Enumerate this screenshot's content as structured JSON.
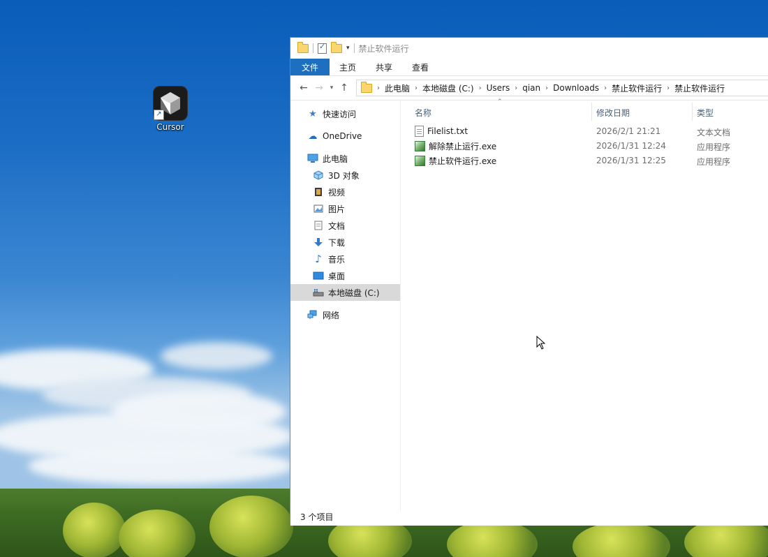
{
  "desktop": {
    "icons": [
      {
        "label": "Cursor",
        "icon": "cursor-app-icon"
      }
    ]
  },
  "explorer": {
    "title": "禁止软件运行",
    "ribbon_tabs": [
      "文件",
      "主页",
      "共享",
      "查看"
    ],
    "address": {
      "crumbs": [
        "此电脑",
        "本地磁盘 (C:)",
        "Users",
        "qian",
        "Downloads",
        "禁止软件运行",
        "禁止软件运行"
      ]
    },
    "nav": {
      "quick_access": "快速访问",
      "onedrive": "OneDrive",
      "this_pc": "此电脑",
      "pc_items": [
        "3D 对象",
        "视频",
        "图片",
        "文档",
        "下载",
        "音乐",
        "桌面",
        "本地磁盘 (C:)"
      ],
      "network": "网络",
      "selected": "本地磁盘 (C:)"
    },
    "columns": {
      "name": "名称",
      "date": "修改日期",
      "type": "类型"
    },
    "files": [
      {
        "name": "Filelist.txt",
        "date": "2026/2/1 21:21",
        "type": "文本文档",
        "icon": "text-file-icon"
      },
      {
        "name": "解除禁止运行.exe",
        "date": "2026/1/31 12:24",
        "type": "应用程序",
        "icon": "exe-file-icon"
      },
      {
        "name": "禁止软件运行.exe",
        "date": "2026/1/31 12:25",
        "type": "应用程序",
        "icon": "exe-file-icon"
      }
    ],
    "status": "3 个项目"
  }
}
